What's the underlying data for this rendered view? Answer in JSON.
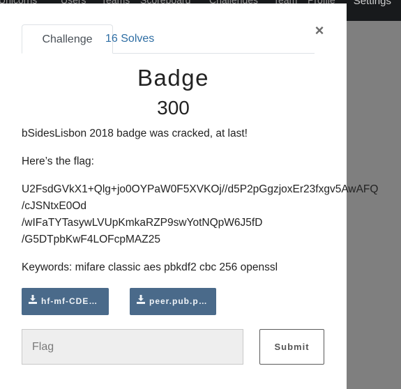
{
  "navbar": {
    "items": [
      "Unicorns",
      "Users",
      "Teams",
      "Scoreboard",
      "Challenges",
      "Team",
      "Profile"
    ],
    "settings": "Settings"
  },
  "modal": {
    "tabs": [
      {
        "label": "Challenge"
      },
      {
        "label": "16 Solves"
      }
    ],
    "close_label": "×",
    "challenge": {
      "name": "Badge",
      "points": "300",
      "description_lines": [
        "bSidesLisbon 2018 badge was cracked, at last!",
        "Here’s the flag:"
      ],
      "flag_lines": [
        "U2FsdGVkX1+Qlg+jo0OYPaW0F5XVKOj//d5P2pGgzjoxEr23fxgv5AwAFQ",
        "/cJSNtxE0Od",
        "/wIFaTYTasywLVUpKmkaRZP9swYotNQpW6J5fD",
        "/G5DTpbKwF4LOFcpMAZ25"
      ],
      "keywords": "Keywords: mifare classic aes pbkdf2 cbc 256 openssl"
    },
    "files": [
      {
        "label": "hf-mf-CDEF..."
      },
      {
        "label": "peer.pub.pem"
      }
    ],
    "flag_form": {
      "placeholder": "Flag",
      "value": "",
      "submit_label": "Submit"
    }
  },
  "colors": {
    "tab_link": "#2d6da3",
    "file_button": "#4a6a8a",
    "backdrop": "#7f7f7f",
    "navbar": "#181a1c"
  },
  "icons": {
    "file_button_icon": "download-icon",
    "close": "close-icon"
  }
}
